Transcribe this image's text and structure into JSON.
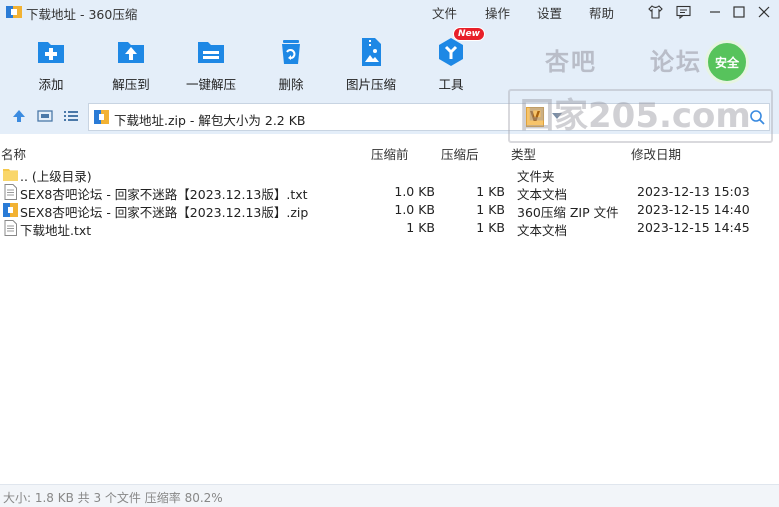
{
  "window": {
    "title": "下载地址 - 360压缩",
    "menu": [
      "文件",
      "操作",
      "设置",
      "帮助"
    ]
  },
  "toolbar": {
    "buttons": [
      {
        "label": "添加",
        "icon": "add-icon"
      },
      {
        "label": "解压到",
        "icon": "extract-to-icon"
      },
      {
        "label": "一键解压",
        "icon": "one-click-extract-icon"
      },
      {
        "label": "删除",
        "icon": "delete-icon"
      },
      {
        "label": "图片压缩",
        "icon": "image-compress-icon"
      },
      {
        "label": "工具",
        "icon": "tools-icon",
        "badge": "New"
      }
    ],
    "safe_label": "安全"
  },
  "address": {
    "path": "下载地址.zip - 解包大小为 2.2 KB",
    "v_label": "V"
  },
  "watermark": {
    "line1a": "杏吧",
    "line1b": "论坛",
    "line2": "回家205.com"
  },
  "list": {
    "headers": {
      "name": "名称",
      "before": "压缩前",
      "after": "压缩后",
      "type": "类型",
      "modified": "修改日期"
    },
    "rows": [
      {
        "name": ".. (上级目录)",
        "before": "",
        "after": "",
        "type": "文件夹",
        "modified": "",
        "icon": "folder-icon"
      },
      {
        "name": "SEX8杏吧论坛 - 回家不迷路【2023.12.13版】.txt",
        "before": "1.0 KB",
        "after": "1 KB",
        "type": "文本文档",
        "modified": "2023-12-13 15:03",
        "icon": "text-file-icon"
      },
      {
        "name": "SEX8杏吧论坛 - 回家不迷路【2023.12.13版】.zip",
        "before": "1.0 KB",
        "after": "1 KB",
        "type": "360压缩 ZIP 文件",
        "modified": "2023-12-15 14:40",
        "icon": "zip-file-icon"
      },
      {
        "name": "下载地址.txt",
        "before": "1 KB",
        "after": "1 KB",
        "type": "文本文档",
        "modified": "2023-12-15 14:45",
        "icon": "text-file-icon"
      }
    ]
  },
  "status": {
    "text": "大小: 1.8 KB 共 3 个文件 压缩率 80.2%"
  },
  "colors": {
    "toolbar_bg": "#e4eef9",
    "accent_blue": "#1e88e5",
    "safe_green": "#57c35c",
    "badge_red": "#e8202a"
  }
}
